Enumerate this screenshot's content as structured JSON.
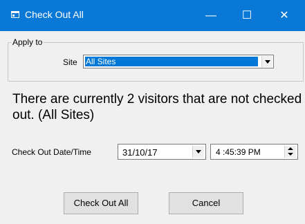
{
  "window": {
    "title": "Check Out All",
    "minimize_glyph": "—",
    "maximize_glyph": "☐",
    "close_glyph": "✕"
  },
  "apply_to": {
    "group_label": "Apply to",
    "site_label": "Site",
    "site_value": "All Sites"
  },
  "message": "There are currently 2 visitors that are not checked out. (All Sites)",
  "checkout": {
    "label": "Check Out Date/Time",
    "date_value": "31/10/17",
    "time_value": "4 :45:39 PM"
  },
  "buttons": {
    "check_out_all": "Check Out All",
    "cancel": "Cancel"
  },
  "colors": {
    "titlebar": "#0a78d7",
    "selection": "#0078d7"
  }
}
